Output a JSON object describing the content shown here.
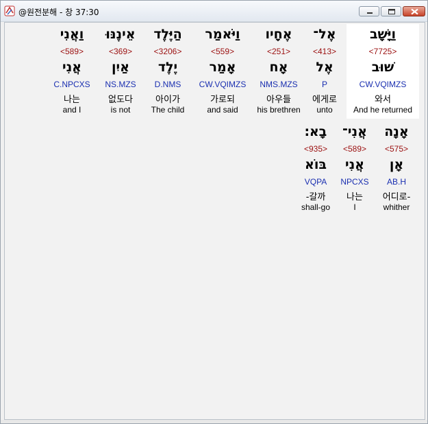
{
  "window": {
    "title": "@원전분해 - 창 37:30"
  },
  "rows": [
    [
      {
        "heb": "וַיָּשָׁב",
        "strong": "<7725>",
        "root": "שׁוּב",
        "morph": "CW.VQIMZS",
        "kor": "와서",
        "eng": "And he returned",
        "highlight": true
      },
      {
        "heb": "אֶל־",
        "strong": "<413>",
        "root": "אֶל",
        "morph": "P",
        "kor": "에게로",
        "eng": "unto",
        "highlight": false
      },
      {
        "heb": "אֶחָיו",
        "strong": "<251>",
        "root": "אָח",
        "morph": "NMS.MZS",
        "kor": "아우들",
        "eng": "his brethren",
        "highlight": false
      },
      {
        "heb": "וַיֹּאמַר",
        "strong": "<559>",
        "root": "אָמַר",
        "morph": "CW.VQIMZS",
        "kor": "가로되",
        "eng": "and said",
        "highlight": false
      },
      {
        "heb": "הַיֶּלֶד",
        "strong": "<3206>",
        "root": "יֶלֶד",
        "morph": "D.NMS",
        "kor": "아이가",
        "eng": "The child",
        "highlight": false
      },
      {
        "heb": "אֵינֶנּוּ",
        "strong": "<369>",
        "root": "אַיִן",
        "morph": "NS.MZS",
        "kor": "없도다",
        "eng": "is not",
        "highlight": false
      },
      {
        "heb": "וַאֲנִי",
        "strong": "<589>",
        "root": "אֲנִי",
        "morph": "C.NPCXS",
        "kor": "나는",
        "eng": "and I",
        "highlight": false
      }
    ],
    [
      {
        "heb": "אָנָה",
        "strong": "<575>",
        "root": "אָן",
        "morph": "AB.H",
        "kor": "어디로-",
        "eng": "whither",
        "highlight": false
      },
      {
        "heb": "אֲנִי־",
        "strong": "<589>",
        "root": "אֲנִי",
        "morph": "NPCXS",
        "kor": "나는",
        "eng": "I",
        "highlight": false
      },
      {
        "heb": "בָא׃",
        "strong": "<935>",
        "root": "בּוֹא",
        "morph": "VQPA",
        "kor": "-갈까",
        "eng": "shall-go",
        "highlight": false
      }
    ]
  ]
}
